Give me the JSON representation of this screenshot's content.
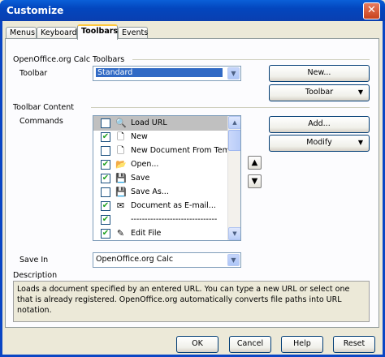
{
  "window": {
    "title": "Customize",
    "close_glyph": "✕"
  },
  "tabs": [
    {
      "label": "Menus",
      "active": false
    },
    {
      "label": "Keyboard",
      "active": false
    },
    {
      "label": "Toolbars",
      "active": true
    },
    {
      "label": "Events",
      "active": false
    }
  ],
  "toolbars_group": {
    "label": "OpenOffice.org Calc Toolbars",
    "toolbar_label": "Toolbar",
    "toolbar_value": "Standard",
    "new_button": "New...",
    "toolbar_button": "Toolbar"
  },
  "content_group": {
    "label": "Toolbar Content",
    "commands_label": "Commands",
    "add_button": "Add...",
    "modify_button": "Modify",
    "commands": [
      {
        "label": "Load URL",
        "checked": false,
        "icon": "globe-search-icon",
        "glyph": "🔍",
        "selected": true
      },
      {
        "label": "New",
        "checked": true,
        "icon": "new-document-icon",
        "glyph": "🗋",
        "selected": false
      },
      {
        "label": "New Document From Template",
        "checked": false,
        "icon": "new-from-template-icon",
        "glyph": "🗋",
        "selected": false
      },
      {
        "label": "Open...",
        "checked": true,
        "icon": "open-folder-icon",
        "glyph": "📂",
        "selected": false
      },
      {
        "label": "Save",
        "checked": true,
        "icon": "save-disk-icon",
        "glyph": "💾",
        "selected": false
      },
      {
        "label": "Save As...",
        "checked": false,
        "icon": "save-as-icon",
        "glyph": "💾",
        "selected": false
      },
      {
        "label": "Document as E-mail...",
        "checked": true,
        "icon": "email-icon",
        "glyph": "✉",
        "selected": false
      },
      {
        "label": "-------------------------------",
        "checked": true,
        "icon": "",
        "glyph": "",
        "selected": false
      },
      {
        "label": "Edit File",
        "checked": true,
        "icon": "edit-file-icon",
        "glyph": "✎",
        "selected": false
      }
    ],
    "check_glyph": "✔",
    "move_up_glyph": "▲",
    "move_down_glyph": "▼"
  },
  "save_in": {
    "label": "Save In",
    "value": "OpenOffice.org Calc"
  },
  "description": {
    "label": "Description",
    "text": "Loads a document specified by an entered URL. You can type a new URL or select one that is already registered. OpenOffice.org automatically converts file paths into URL notation."
  },
  "buttons": {
    "ok": "OK",
    "cancel": "Cancel",
    "help": "Help",
    "reset": "Reset"
  },
  "glyphs": {
    "dropdown": "▼",
    "scroll_up": "▲",
    "scroll_down": "▼"
  }
}
